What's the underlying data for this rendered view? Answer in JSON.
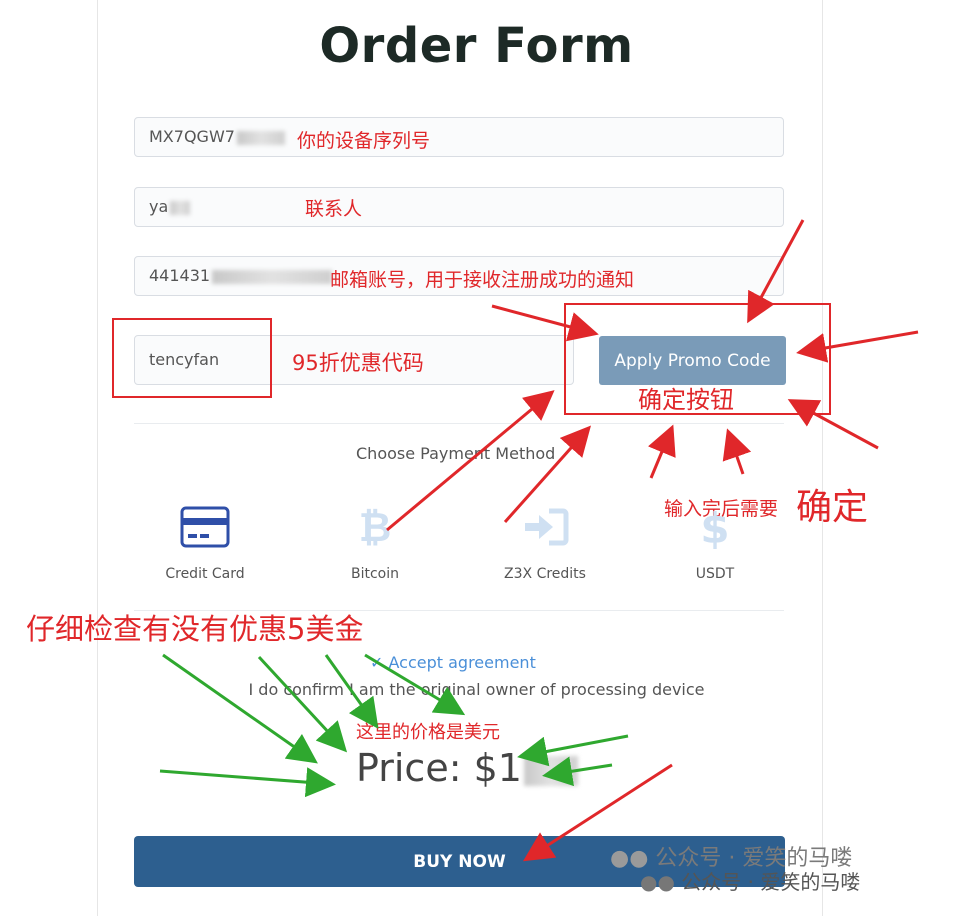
{
  "form": {
    "title": "Order Form",
    "serial_value": "MX7QGW7",
    "contact_value": "ya",
    "email_value": "441431",
    "promo_value": "tencyfan",
    "apply_label": "Apply Promo Code",
    "payment_heading": "Choose Payment Method",
    "payment_methods": [
      {
        "label": "Credit Card",
        "icon": "credit-card-icon"
      },
      {
        "label": "Bitcoin",
        "icon": "bitcoin-icon"
      },
      {
        "label": "Z3X Credits",
        "icon": "login-arrow-icon"
      },
      {
        "label": "USDT",
        "icon": "dollar-icon"
      }
    ],
    "accept_label": "Accept agreement",
    "confirm_text": "I do confirm I am the original owner of processing device",
    "price_label": "Price: $1",
    "buy_label": "BUY NOW"
  },
  "annotations": {
    "serial_note": "你的设备序列号",
    "contact_note": "联系人",
    "email_note": "邮箱账号，用于接收注册成功的通知",
    "promo_note": "95折优惠代码",
    "confirm_button_note": "确定按钮",
    "after_input_small": "输入完后需要",
    "after_input_big": "确定",
    "check_discount": "仔细检查有没有优惠5美金",
    "price_usd": "这里的价格是美元"
  },
  "watermark": {
    "text1": "公众号 · 爱笑的马喽",
    "text2": "公众号 · 爱笑的马喽"
  },
  "colors": {
    "title": "#1d2a26",
    "apply_button": "#7a9bb8",
    "buy_button": "#2d5f8f",
    "annotation_red": "#e0272a",
    "arrow_green": "#2fa82f",
    "icon_blue": "#2f4fa8",
    "icon_light": "#cfe0f2",
    "accept_blue": "#4a8fd8"
  }
}
